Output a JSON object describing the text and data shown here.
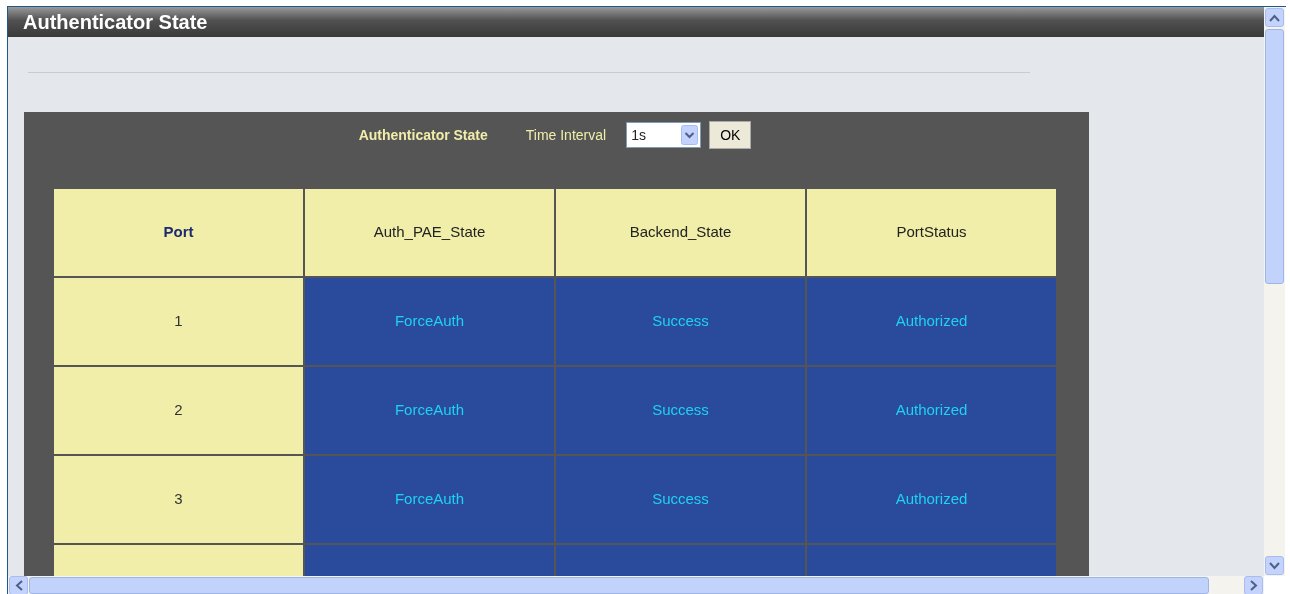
{
  "window": {
    "title": "Authenticator State"
  },
  "toolbar": {
    "label": "Authenticator State",
    "interval_label": "Time Interval",
    "interval_value": "1s",
    "ok_button": "OK"
  },
  "table": {
    "columns": [
      "Port",
      "Auth_PAE_State",
      "Backend_State",
      "PortStatus"
    ],
    "rows": [
      {
        "port": "1",
        "auth_pae_state": "ForceAuth",
        "backend_state": "Success",
        "port_status": "Authorized"
      },
      {
        "port": "2",
        "auth_pae_state": "ForceAuth",
        "backend_state": "Success",
        "port_status": "Authorized"
      },
      {
        "port": "3",
        "auth_pae_state": "ForceAuth",
        "backend_state": "Success",
        "port_status": "Authorized"
      }
    ]
  }
}
